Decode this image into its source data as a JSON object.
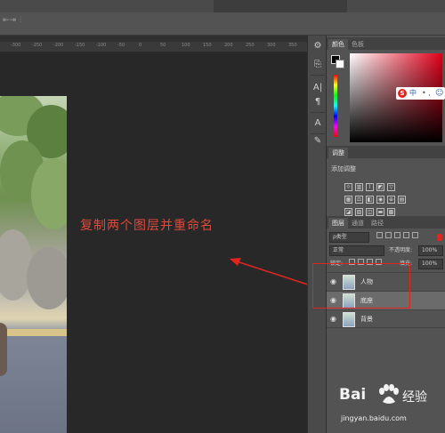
{
  "annotation": {
    "text": "复制两个图层并重命名",
    "color": "#e04a3a"
  },
  "ruler": {
    "ticks": [
      "-300",
      "-250",
      "-200",
      "-150",
      "-100",
      "-50",
      "0",
      "50",
      "100",
      "150",
      "200",
      "250",
      "300",
      "350"
    ]
  },
  "color_panel": {
    "tabs": [
      "颜色",
      "色板"
    ],
    "ime": {
      "logo": "S",
      "text": "中",
      "dots": "• ,",
      "smiley": "☺"
    }
  },
  "adjust_panel": {
    "tab": "调整",
    "label": "添加调整"
  },
  "layers_panel": {
    "tabs": [
      "图层",
      "通道",
      "路径"
    ],
    "filter_label": "ρ类型",
    "blend_mode": "正常",
    "opacity_label": "不透明度:",
    "opacity_value": "100%",
    "lock_label": "锁定:",
    "fill_label": "填充:",
    "fill_value": "100%",
    "layers": [
      {
        "name": "人物",
        "selected": false
      },
      {
        "name": "底座",
        "selected": true
      },
      {
        "name": "背景",
        "selected": false
      }
    ]
  },
  "watermark": {
    "brand_left": "Bai",
    "brand_right": "经验",
    "url": "jingyan.baidu.com"
  },
  "colors": {
    "accent_red": "#e0251f",
    "panel_bg": "#535353",
    "canvas_bg": "#282828"
  }
}
